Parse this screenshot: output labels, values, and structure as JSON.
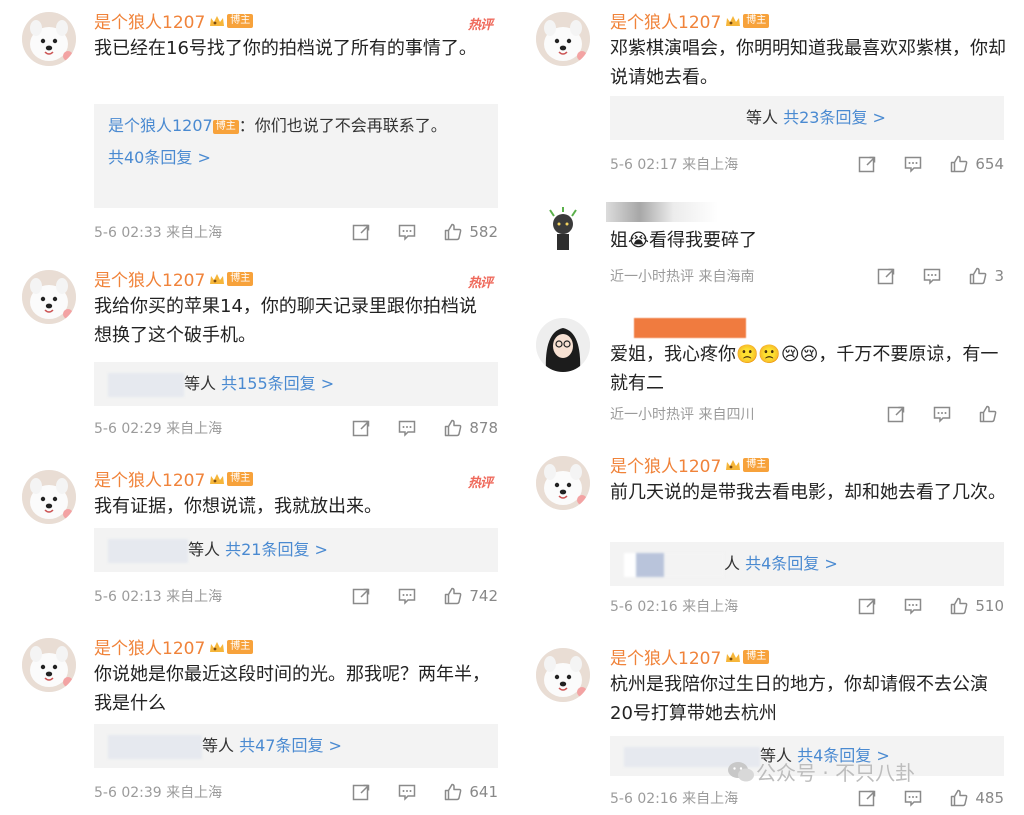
{
  "left_comments": [
    {
      "name": "是个狼人1207",
      "badge": "博主",
      "hot": "热评",
      "text": "我已经在16号找了你的拍档说了所有的事情了。",
      "reply_name": "是个狼人1207",
      "reply_badge": "博主",
      "reply_text": "：你们也说了不会再联系了。",
      "reply_count": "共40条回复 >",
      "time": "5-6 02:33 来自上海",
      "likes": "582"
    },
    {
      "name": "是个狼人1207",
      "badge": "博主",
      "hot": "热评",
      "text": "我给你买的苹果14，你的聊天记录里跟你拍档说想换了这个破手机。",
      "reply_prefix": "等人",
      "reply_count": "共155条回复 >",
      "time": "5-6 02:29 来自上海",
      "likes": "878"
    },
    {
      "name": "是个狼人1207",
      "badge": "博主",
      "hot": "热评",
      "text": "我有证据，你想说谎，我就放出来。",
      "reply_prefix": "等人",
      "reply_count": "共21条回复 >",
      "time": "5-6 02:13 来自上海",
      "likes": "742"
    },
    {
      "name": "是个狼人1207",
      "badge": "博主",
      "text": "你说她是你最近这段时间的光。那我呢？两年半，我是什么",
      "reply_prefix": "等人",
      "reply_count": "共47条回复 >",
      "time": "5-6 02:39 来自上海",
      "likes": "641"
    }
  ],
  "right_comments": [
    {
      "name": "是个狼人1207",
      "badge": "博主",
      "text": "邓紫棋演唱会，你明明知道我最喜欢邓紫棋，你却说请她去看。",
      "reply_prefix": "等人",
      "reply_count": "共23条回复 >",
      "time": "5-6 02:17 来自上海",
      "likes": "654"
    },
    {
      "text": "姐😭看得我要碎了",
      "time": "近一小时热评 来自海南",
      "likes": "3"
    },
    {
      "text": "爱姐，我心疼你🙁🙁😢😢，千万不要原谅，有一就有二",
      "time": "近一小时热评 来自四川",
      "likes": ""
    },
    {
      "name": "是个狼人1207",
      "badge": "博主",
      "text": "前几天说的是带我去看电影，却和她去看了几次。",
      "reply_prefix": "人",
      "reply_count": "共4条回复 >",
      "time": "5-6 02:16 来自上海",
      "likes": "510"
    },
    {
      "name": "是个狼人1207",
      "badge": "博主",
      "text": "杭州是我陪你过生日的地方，你却请假不去公演20号打算带她去杭州",
      "reply_prefix": "等人",
      "reply_count": "共4条回复 >",
      "time": "5-6 02:16 来自上海",
      "likes": "485"
    }
  ],
  "watermark": "公众号 · 不只八卦",
  "colors": {
    "name": "#f0833a",
    "link": "#4a8ad1",
    "meta": "#9b9b9b",
    "reply_bg": "#f3f3f3"
  },
  "icons": [
    "share-icon",
    "comment-icon",
    "like-icon",
    "wechat-icon"
  ]
}
